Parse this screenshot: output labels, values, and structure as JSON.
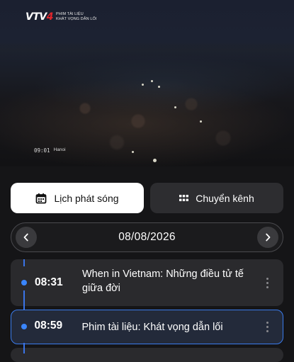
{
  "player": {
    "channel_logo": "VTV4",
    "logo_line1": "PHIM TÀI LIỆU",
    "logo_line2": "KHÁT VỌNG DẪN LỐI",
    "osd_time": "09:01",
    "osd_city": "Hanoi"
  },
  "actions": {
    "schedule_label": "Lịch phát sóng",
    "schedule_icon": "calendar-icon",
    "switch_label": "Chuyển kênh",
    "switch_icon": "grid-icon"
  },
  "date_nav": {
    "date": "08/08/2026",
    "prev_icon": "chevron-left-icon",
    "next_icon": "chevron-right-icon"
  },
  "schedule": [
    {
      "time": "08:31",
      "title": "When in Vietnam: Những điều tử tế giữa đời",
      "active": false
    },
    {
      "time": "08:59",
      "title": "Phim tài liệu: Khát vọng dẫn lối",
      "active": true
    }
  ],
  "colors": {
    "background": "#151517",
    "accent": "#3a7bec",
    "primary_button": "#ffffff",
    "secondary_button": "#2d2d30",
    "logo_red": "#e0262c"
  }
}
